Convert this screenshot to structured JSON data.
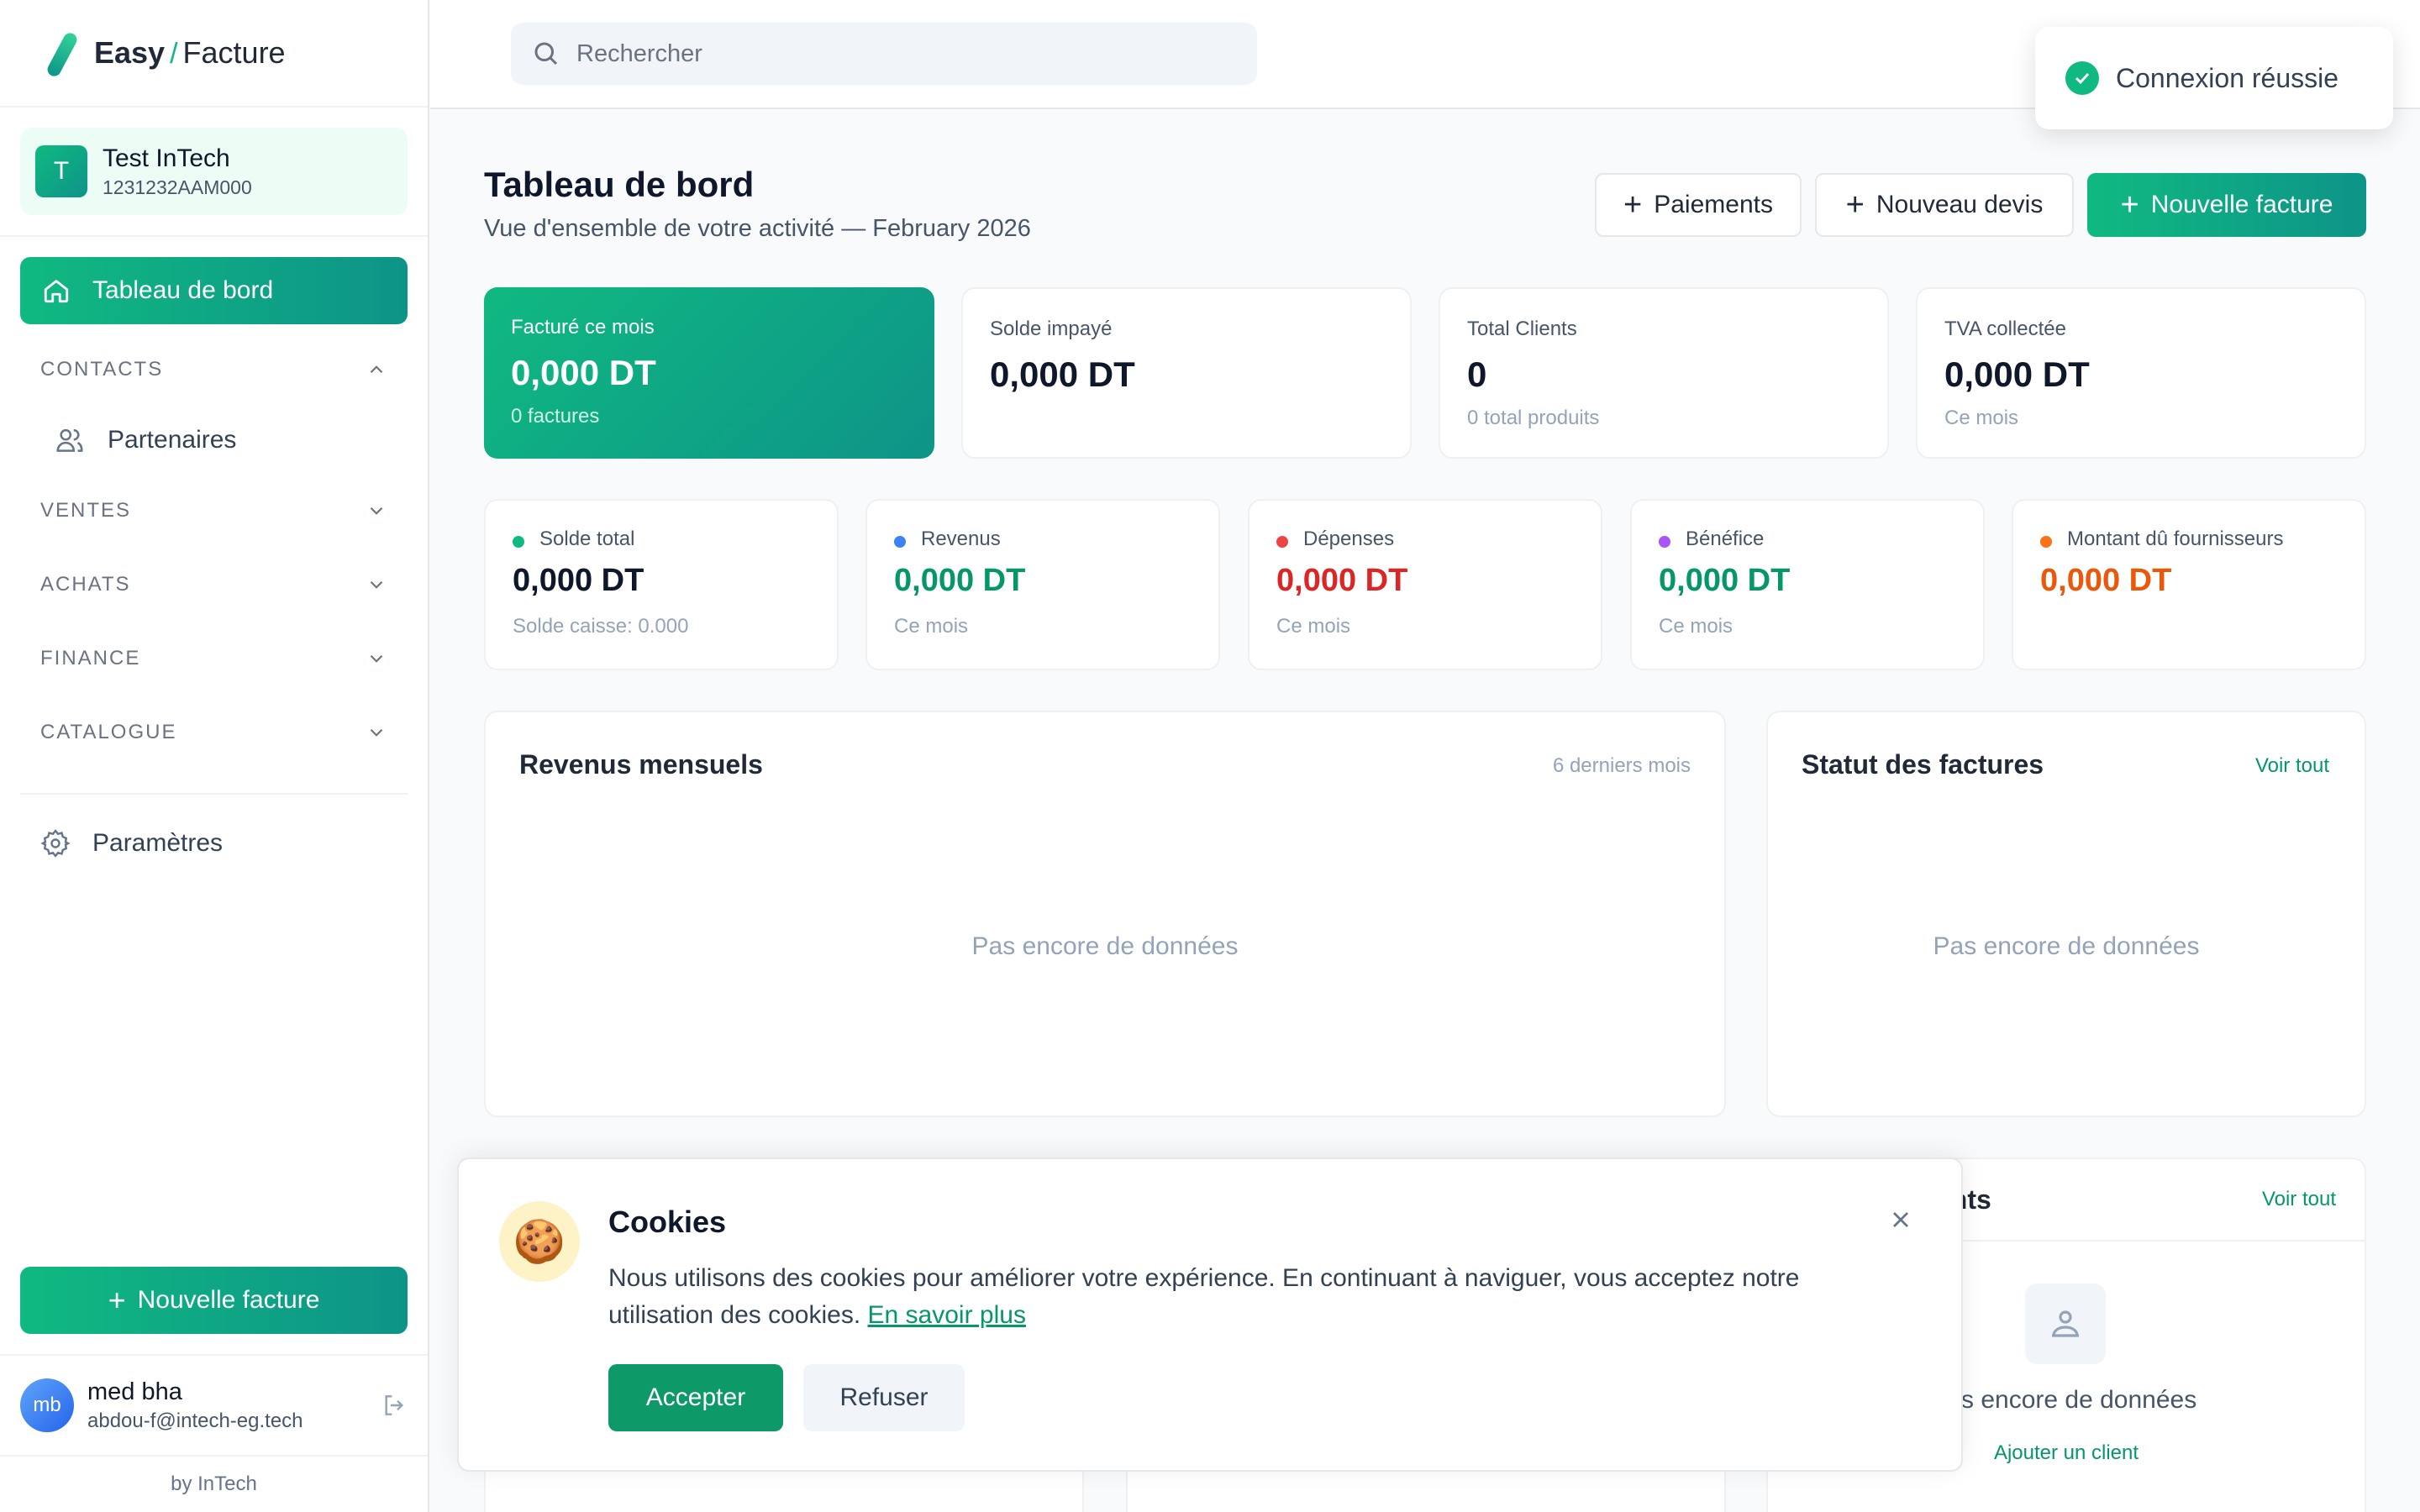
{
  "brand": {
    "easy": "Easy",
    "slash": "/",
    "facture": "Facture"
  },
  "company": {
    "initial": "T",
    "name": "Test InTech",
    "id": "1231232AAM000"
  },
  "nav": {
    "dashboard": "Tableau de bord",
    "groups": [
      "CONTACTS",
      "VENTES",
      "ACHATS",
      "FINANCE",
      "CATALOGUE"
    ],
    "contacts_items": [
      "Partenaires"
    ],
    "settings": "Paramètres",
    "new_invoice": "Nouvelle facture"
  },
  "user": {
    "initials": "mb",
    "name": "med bha",
    "email": "abdou-f@intech-eg.tech"
  },
  "footer": "by InTech",
  "search": {
    "placeholder": "Rechercher"
  },
  "toast": "Connexion réussie",
  "header": {
    "title": "Tableau de bord",
    "subtitle": "Vue d'ensemble de votre activité — February 2026"
  },
  "actions": {
    "payments": "Paiements",
    "quote": "Nouveau devis",
    "invoice": "Nouvelle facture"
  },
  "kpis": [
    {
      "label": "Facturé ce mois",
      "value": "0,000 DT",
      "sub": "0 factures"
    },
    {
      "label": "Solde impayé",
      "value": "0,000 DT",
      "sub": ""
    },
    {
      "label": "Total Clients",
      "value": "0",
      "sub": "0 total produits"
    },
    {
      "label": "TVA collectée",
      "value": "0,000 DT",
      "sub": "Ce mois"
    }
  ],
  "minis": [
    {
      "label": "Solde total",
      "value": "0,000 DT",
      "sub": "Solde caisse: 0.000",
      "color": "#10b981",
      "value_color": "#0f172a"
    },
    {
      "label": "Revenus",
      "value": "0,000 DT",
      "sub": "Ce mois",
      "color": "#3b82f6",
      "value_color": "#059669"
    },
    {
      "label": "Dépenses",
      "value": "0,000 DT",
      "sub": "Ce mois",
      "color": "#ef4444",
      "value_color": "#dc2626"
    },
    {
      "label": "Bénéfice",
      "value": "0,000 DT",
      "sub": "Ce mois",
      "color": "#a855f7",
      "value_color": "#059669"
    },
    {
      "label": "Montant dû fournisseurs",
      "value": "0,000 DT",
      "sub": "",
      "color": "#f97316",
      "value_color": "#ea580c"
    }
  ],
  "revenue": {
    "title": "Revenus mensuels",
    "range": "6 derniers mois",
    "empty": "Pas encore de données"
  },
  "status": {
    "title": "Statut des factures",
    "link": "Voir tout",
    "empty": "Pas encore de données"
  },
  "clients": {
    "title_partial": "ents",
    "link": "Voir tout",
    "empty_partial": "s encore de données",
    "add": "Ajouter un client"
  },
  "cookie": {
    "title": "Cookies",
    "text": "Nous utilisons des cookies pour améliorer votre expérience. En continuant à naviguer, vous acceptez notre utilisation des cookies.",
    "link": "En savoir plus",
    "accept": "Accepter",
    "refuse": "Refuser"
  },
  "colors": {
    "accent": "#10b981",
    "accent_dark": "#0d9488"
  }
}
